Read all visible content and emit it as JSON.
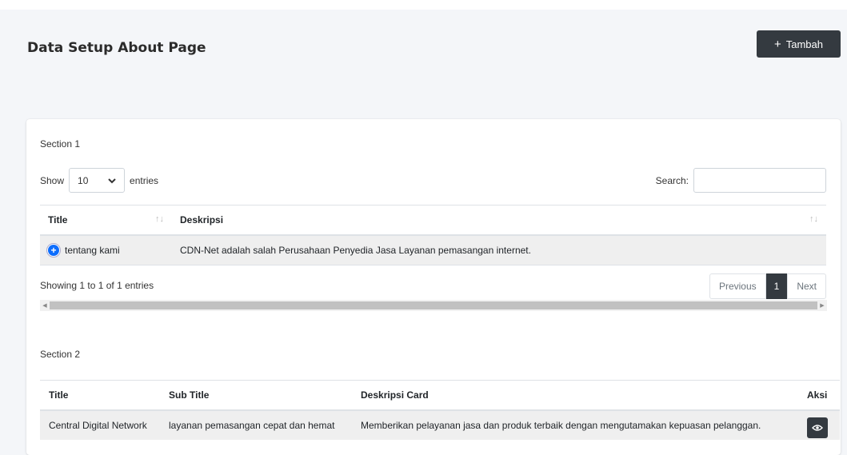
{
  "page": {
    "title": "Data Setup About Page",
    "add_button_label": "Tambah",
    "add_button_icon": "plus-icon"
  },
  "section1": {
    "title": "Section 1",
    "show_label": "Show",
    "entries_value": "10",
    "entries_label": "entries",
    "search_label": "Search:",
    "search_value": "",
    "columns": [
      "Title",
      "Deskripsi"
    ],
    "rows": [
      {
        "title": "tentang kami",
        "deskripsi": "CDN-Net adalah salah Perusahaan Penyedia Jasa Layanan pemasangan internet."
      }
    ],
    "info": "Showing 1 to 1 of 1 entries",
    "pagination": {
      "previous": "Previous",
      "current": "1",
      "next": "Next"
    }
  },
  "section2": {
    "title": "Section 2",
    "columns": [
      "Title",
      "Sub Title",
      "Deskripsi Card",
      "Aksi"
    ],
    "rows": [
      {
        "title": "Central Digital Network",
        "subtitle": "layanan pemasangan cepat dan hemat",
        "deskripsi": "Memberikan pelayanan jasa dan produk terbaik dengan mengutamakan kepuasan pelanggan.",
        "action_icon": "eye-icon"
      }
    ]
  },
  "colors": {
    "dark": "#343a40",
    "accent": "#0d6efd",
    "background": "#f4f6f9"
  }
}
